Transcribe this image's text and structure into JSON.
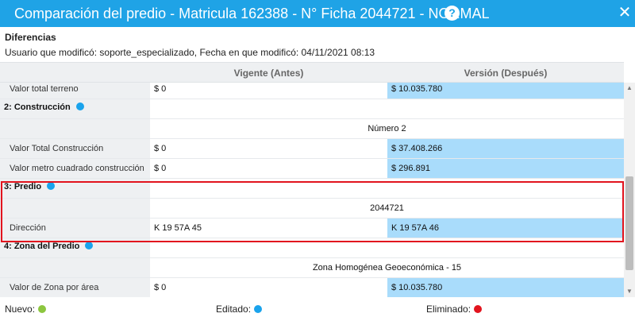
{
  "window": {
    "title": "Comparación del predio - Matricula 162388 - N° Ficha 2044721 - NORMAL",
    "help_label": "?",
    "close_label": "✕"
  },
  "diff": {
    "heading": "Diferencias",
    "info": "Usuario que modificó: soporte_especializado, Fecha en que modificó: 04/11/2021 08:13"
  },
  "columns": {
    "before": "Vigente (Antes)",
    "after": "Versión (Después)"
  },
  "rows": {
    "r0": {
      "label": "Valor total terreno",
      "before": "$ 0",
      "after": "$ 10.035.780"
    },
    "s2": {
      "label": "2: Construcción"
    },
    "s2_sub": {
      "value": "Número 2"
    },
    "r1": {
      "label": "Valor Total Construcción",
      "before": "$ 0",
      "after": "$ 37.408.266"
    },
    "r2": {
      "label": "Valor metro cuadrado construcción",
      "before": "$ 0",
      "after": "$ 296.891"
    },
    "s3": {
      "label": "3: Predio"
    },
    "s3_sub": {
      "value": "2044721"
    },
    "r3": {
      "label": "Dirección",
      "before": "K 19 57A 45",
      "after": "K 19 57A 46"
    },
    "s4": {
      "label": "4: Zona del Predio"
    },
    "s4_sub": {
      "value": "Zona Homogénea Geoeconómica - 15"
    },
    "r4": {
      "label": "Valor de Zona por área",
      "before": "$ 0",
      "after": "$ 10.035.780"
    }
  },
  "legend": {
    "nuevo": "Nuevo:",
    "editado": "Editado:",
    "eliminado": "Eliminado:"
  },
  "colors": {
    "title_bar": "#1fa3e6",
    "changed_cell": "#a9dcfb",
    "highlight_border": "#e2141e",
    "nuevo": "#8cc63f",
    "editado": "#1aa3ec",
    "eliminado": "#e2141e"
  }
}
